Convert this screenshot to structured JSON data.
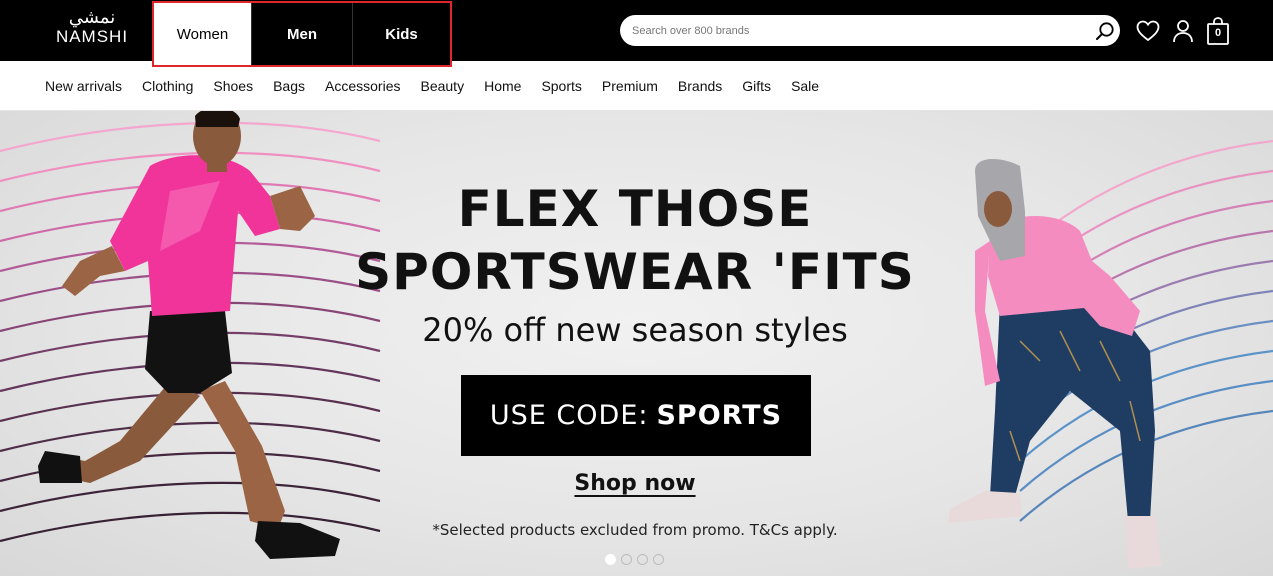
{
  "brand": {
    "logo_arabic": "نمشي",
    "logo_text": "NAMSHI"
  },
  "gender_tabs": [
    {
      "label": "Women",
      "active": true
    },
    {
      "label": "Men",
      "active": false
    },
    {
      "label": "Kids",
      "active": false
    }
  ],
  "search": {
    "placeholder": "Search over 800 brands",
    "value": ""
  },
  "icons": {
    "search": "search-icon",
    "wishlist": "heart-icon",
    "account": "user-icon",
    "bag": "shopping-bag-icon"
  },
  "bag_count": "0",
  "categories": [
    "New arrivals",
    "Clothing",
    "Shoes",
    "Bags",
    "Accessories",
    "Beauty",
    "Home",
    "Sports",
    "Premium",
    "Brands",
    "Gifts",
    "Sale"
  ],
  "hero": {
    "headline_line1": "FLEX THOSE",
    "headline_line2": "SPORTSWEAR 'FITS",
    "subheadline": "20% off new season styles",
    "code_prefix": "USE CODE:",
    "code": "SPORTS",
    "cta": "Shop now",
    "disclaimer": "*Selected products excluded from promo. T&Cs apply.",
    "slides": 4,
    "active_slide": 1
  },
  "colors": {
    "topbar": "#000000",
    "highlight_border": "#e0262b",
    "shirt_pink": "#f0349a",
    "top_pink": "#f58cc0",
    "leggings_navy": "#1f3d63"
  }
}
